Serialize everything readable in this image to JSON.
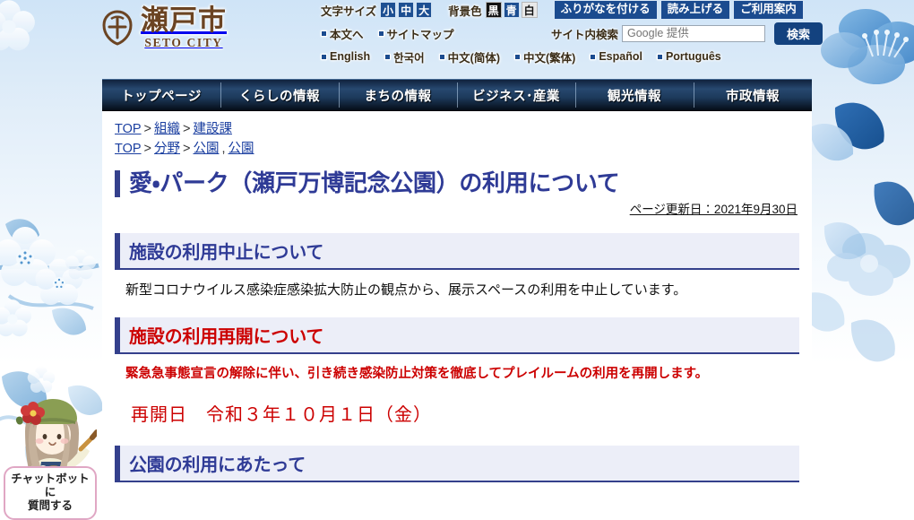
{
  "site": {
    "logo_jp": "瀬戸市",
    "logo_en": "SETO CITY"
  },
  "header": {
    "font_size_label": "文字サイズ",
    "font_sizes": [
      "小",
      "中",
      "大"
    ],
    "bg_color_label": "背景色",
    "bg_colors": [
      "黒",
      "青",
      "白"
    ],
    "buttons": [
      "ふりがなを付ける",
      "読み上げる",
      "ご利用案内"
    ],
    "skip_links": [
      "本文へ",
      "サイトマップ"
    ],
    "search_label": "サイト内検索",
    "search_placeholder": "Google 提供",
    "search_value": "",
    "search_button": "検索",
    "languages": [
      "English",
      "한국어",
      "中文(简体)",
      "中文(繁体)",
      "Español",
      "Português"
    ]
  },
  "gnav": [
    "トップページ",
    "くらしの情報",
    "まちの情報",
    "ビジネス･産業",
    "観光情報",
    "市政情報"
  ],
  "breadcrumbs": [
    {
      "items": [
        "TOP",
        "組織",
        "建設課"
      ],
      "seps": [
        ">",
        ">"
      ]
    },
    {
      "items": [
        "TOP",
        "分野",
        "公園",
        "公園"
      ],
      "seps": [
        ">",
        ">",
        ","
      ]
    }
  ],
  "main": {
    "title": "愛・パーク（瀬戸万博記念公園）の利用について",
    "update_date": "ページ更新日：2021年9月30日",
    "sections": [
      {
        "heading": "施設の利用中止について",
        "heading_color": "#2f3b96",
        "body": "新型コロナウイルス感染症感染拡大防止の観点から、展示スペースの利用を中止しています。"
      },
      {
        "heading": "施設の利用再開について",
        "heading_color": "#cc0000",
        "body": "緊急急事態宣言の解除に伴い、引き続き感染防止対策を徹底してプレイルームの利用を再開します。",
        "note": "再開日　令和３年１０月１日（金）"
      },
      {
        "heading": "公園の利用にあたって",
        "heading_color": "#2f3b96"
      }
    ]
  },
  "chatbot": {
    "label_line1": "チャットボットに",
    "label_line2": "質問する"
  },
  "colors": {
    "brand_navy": "#34408c",
    "nav_dark": "#10223c",
    "accent_red": "#cc0000",
    "util_blue": "#1b4b8f",
    "logo_brown": "#6b4423",
    "chat_pink": "#e0a7c4"
  }
}
